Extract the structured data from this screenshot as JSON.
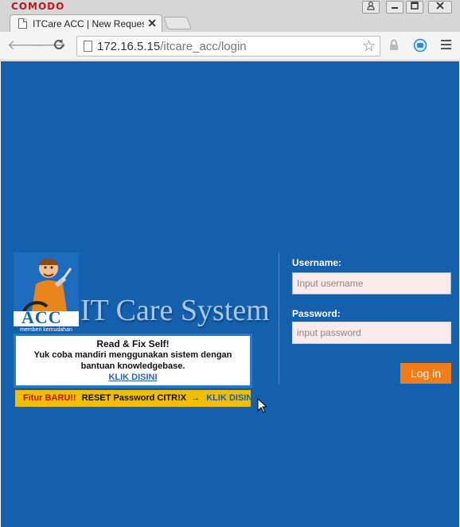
{
  "browser": {
    "brand": "COMODO",
    "tab_title": "ITCare ACC | New Request",
    "url_host": "172.16.5.15",
    "url_path": "/itcare_acc/login"
  },
  "page": {
    "acc_logo_text": "ACC",
    "acc_tagline": "memberi kemudahan",
    "system_title": "IT Care System",
    "info": {
      "heading": "Read & Fix Self!",
      "text": "Yuk coba mandiri menggunakan sistem dengan bantuan knowledgebase.",
      "link": "KLIK DISINI"
    },
    "promo": {
      "new_label": "Fitur BARU!!",
      "text": "RESET  Password CITR!X",
      "arrow": "→",
      "link": "KLIK DISINI"
    },
    "login": {
      "username_label": "Username:",
      "username_placeholder": "Input username",
      "password_label": "Password:",
      "password_placeholder": "input password",
      "submit_label": "Log in"
    }
  },
  "colors": {
    "page_background": "#1560ad",
    "login_button": "#f07c1a",
    "promo_bar": "#f0be00",
    "brand": "#c0151c"
  }
}
